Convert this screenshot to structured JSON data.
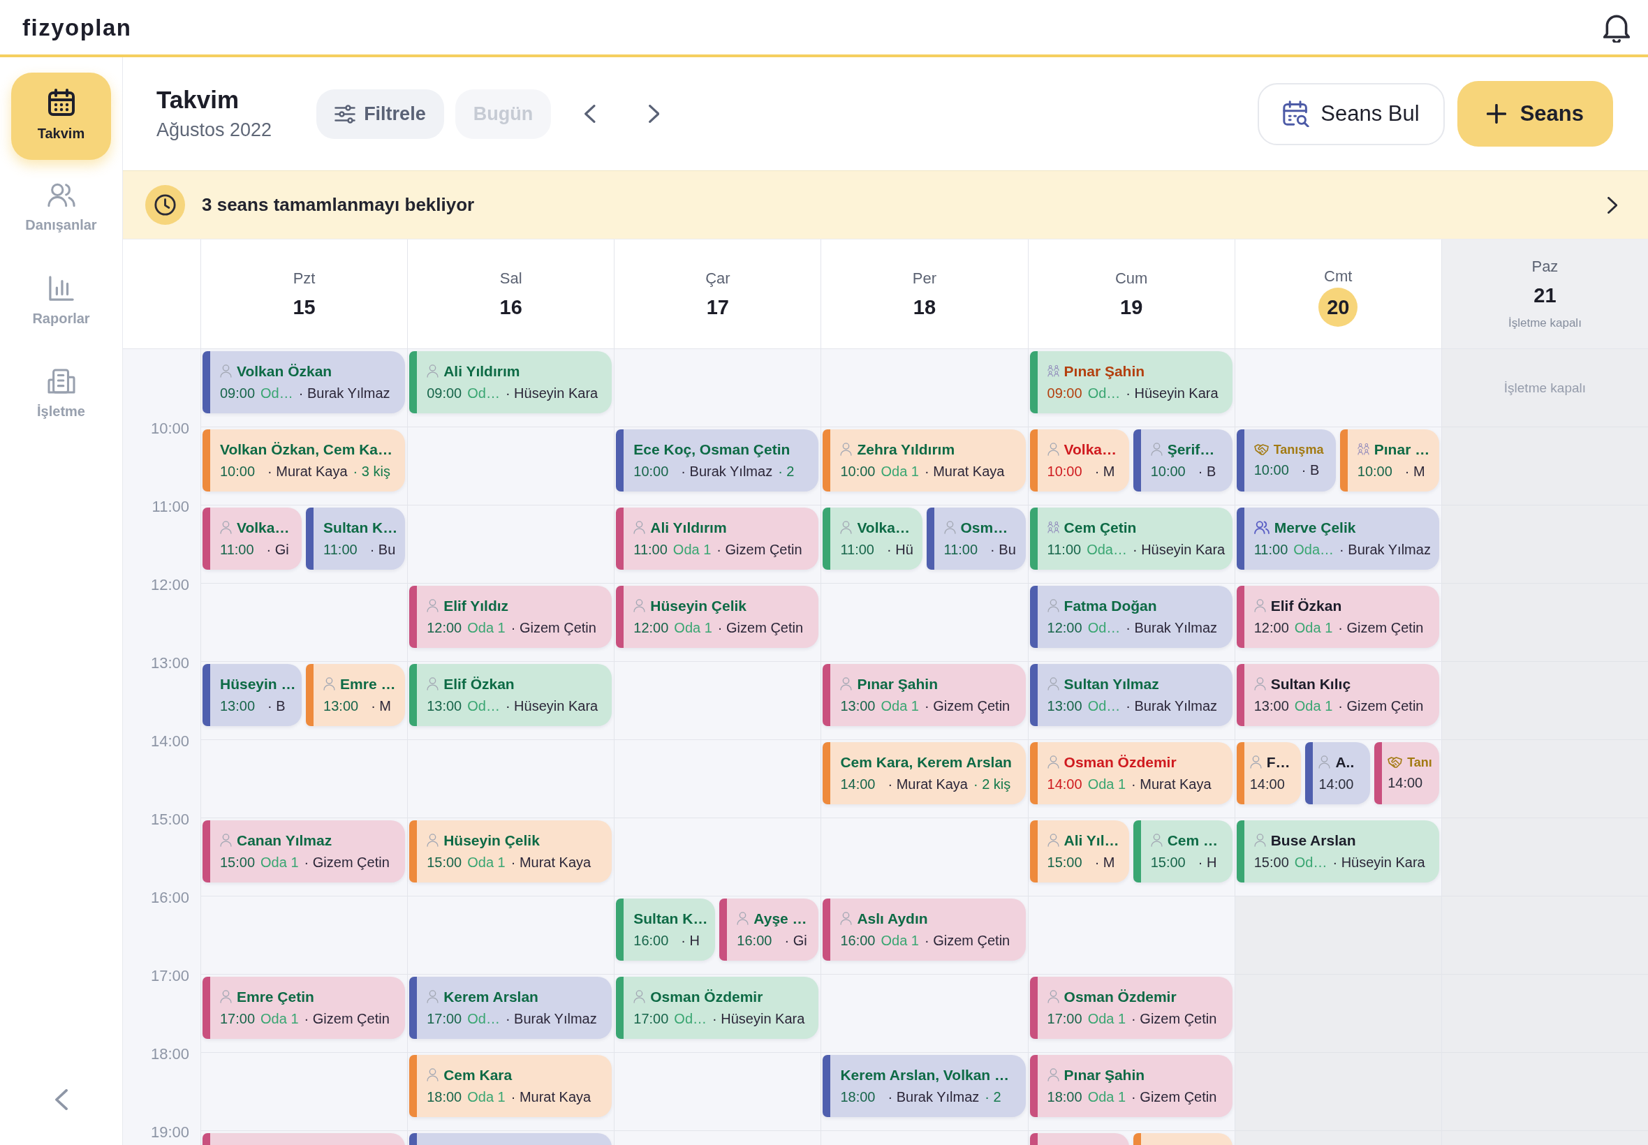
{
  "topbar": {
    "logo": "fizyoplan"
  },
  "sidebar": {
    "items": [
      {
        "label": "Takvim",
        "selected": true
      },
      {
        "label": "Danışanlar",
        "selected": false
      },
      {
        "label": "Raporlar",
        "selected": false
      },
      {
        "label": "İşletme",
        "selected": false
      }
    ]
  },
  "header": {
    "title": "Takvim",
    "subtitle": "Ağustos 2022",
    "filter_button": "Filtrele",
    "today_button": {
      "label": "Bugün",
      "disabled": true
    },
    "find_button": "Seans Bul",
    "new_button": "Seans"
  },
  "banner": {
    "text": "3 seans tamamlanmayı bekliyor"
  },
  "calendar": {
    "hours": [
      "10:00",
      "11:00",
      "12:00",
      "13:00",
      "14:00",
      "15:00",
      "16:00",
      "17:00",
      "18:00",
      "19:00"
    ],
    "days": [
      {
        "name": "Pzt",
        "date": "15",
        "today": false,
        "closed": false,
        "slots": [
          {
            "kind": "open",
            "events": [
              {
                "name": "Volkan Özkan",
                "kind": "individual",
                "awaiting_completion": false,
                "upcoming": false,
                "time": "09:00",
                "room": "Od…",
                "therapist": "· Burak Yılmaz",
                "color": "#4f5fae"
              }
            ]
          },
          {
            "kind": "open",
            "events": [
              {
                "name": "Volkan Özkan, Cem Ka…",
                "kind": "multi",
                "awaiting_completion": false,
                "upcoming": false,
                "time": "10:00",
                "therapist": "· Murat Kaya",
                "participants": "· 3 kiş",
                "color": "#ee8a3c"
              }
            ]
          },
          {
            "kind": "open",
            "events": [
              {
                "name": "Volka…",
                "kind": "individual",
                "awaiting_completion": false,
                "upcoming": false,
                "time": "11:00",
                "therapist": "· Gi",
                "color": "#c9507e"
              },
              {
                "name": "Sultan K…",
                "kind": "multi",
                "awaiting_completion": false,
                "upcoming": false,
                "time": "11:00",
                "therapist": "· Bu",
                "color": "#4f5fae"
              }
            ]
          },
          {
            "kind": "open"
          },
          {
            "kind": "open",
            "events": [
              {
                "name": "Hüseyin …",
                "kind": "multi",
                "awaiting_completion": false,
                "upcoming": false,
                "time": "13:00",
                "therapist": "· B",
                "color": "#4f5fae"
              },
              {
                "name": "Emre …",
                "kind": "individual",
                "awaiting_completion": false,
                "upcoming": false,
                "time": "13:00",
                "therapist": "· M",
                "color": "#ee8a3c"
              }
            ]
          },
          {
            "kind": "open"
          },
          {
            "kind": "open",
            "events": [
              {
                "name": "Canan Yılmaz",
                "kind": "individual",
                "awaiting_completion": false,
                "upcoming": false,
                "time": "15:00",
                "room": "Oda 1",
                "therapist": "· Gizem Çetin",
                "color": "#c9507e"
              }
            ]
          },
          {
            "kind": "open"
          },
          {
            "kind": "open",
            "events": [
              {
                "name": "Emre Çetin",
                "kind": "individual",
                "awaiting_completion": false,
                "upcoming": false,
                "time": "17:00",
                "room": "Oda 1",
                "therapist": "· Gizem Çetin",
                "color": "#c9507e"
              }
            ]
          },
          {
            "kind": "open"
          },
          {
            "kind": "open",
            "events": [
              {
                "color": "#c9507e"
              }
            ]
          }
        ]
      },
      {
        "name": "Sal",
        "date": "16",
        "today": false,
        "closed": false,
        "slots": [
          {
            "kind": "open",
            "events": [
              {
                "name": "Ali Yıldırım",
                "kind": "individual",
                "awaiting_completion": false,
                "upcoming": false,
                "time": "09:00",
                "room": "Od…",
                "therapist": "· Hüseyin Kara",
                "color": "#3aa672"
              }
            ]
          },
          {
            "kind": "open"
          },
          {
            "kind": "open"
          },
          {
            "kind": "open",
            "events": [
              {
                "name": "Elif Yıldız",
                "kind": "individual",
                "awaiting_completion": false,
                "upcoming": false,
                "time": "12:00",
                "room": "Oda 1",
                "therapist": "· Gizem Çetin",
                "color": "#c9507e"
              }
            ]
          },
          {
            "kind": "open",
            "events": [
              {
                "name": "Elif Özkan",
                "kind": "individual",
                "awaiting_completion": false,
                "upcoming": false,
                "time": "13:00",
                "room": "Od…",
                "therapist": "· Hüseyin Kara",
                "color": "#3aa672"
              }
            ]
          },
          {
            "kind": "open"
          },
          {
            "kind": "open",
            "events": [
              {
                "name": "Hüseyin Çelik",
                "kind": "individual",
                "awaiting_completion": false,
                "upcoming": false,
                "time": "15:00",
                "room": "Oda 1",
                "therapist": "· Murat Kaya",
                "color": "#ee8a3c"
              }
            ]
          },
          {
            "kind": "open"
          },
          {
            "kind": "open",
            "events": [
              {
                "name": "Kerem Arslan",
                "kind": "individual",
                "awaiting_completion": false,
                "upcoming": false,
                "time": "17:00",
                "room": "Od…",
                "therapist": "· Burak Yılmaz",
                "color": "#4f5fae"
              }
            ]
          },
          {
            "kind": "open",
            "events": [
              {
                "name": "Cem Kara",
                "kind": "individual",
                "awaiting_completion": false,
                "upcoming": false,
                "time": "18:00",
                "room": "Oda 1",
                "therapist": "· Murat Kaya",
                "color": "#ee8a3c"
              }
            ]
          },
          {
            "kind": "open",
            "events": [
              {
                "color": "#4f5fae"
              }
            ]
          }
        ]
      },
      {
        "name": "Çar",
        "date": "17",
        "today": false,
        "closed": false,
        "slots": [
          {
            "kind": "open"
          },
          {
            "kind": "open",
            "events": [
              {
                "name": "Ece Koç, Osman Çetin",
                "kind": "multi",
                "awaiting_completion": false,
                "upcoming": false,
                "time": "10:00",
                "therapist": "· Burak Yılmaz",
                "participants": "· 2",
                "color": "#4f5fae"
              }
            ]
          },
          {
            "kind": "open",
            "events": [
              {
                "name": "Ali Yıldırım",
                "kind": "individual",
                "awaiting_completion": false,
                "upcoming": false,
                "time": "11:00",
                "room": "Oda 1",
                "therapist": "· Gizem Çetin",
                "color": "#c9507e"
              }
            ]
          },
          {
            "kind": "open",
            "events": [
              {
                "name": "Hüseyin Çelik",
                "kind": "individual",
                "awaiting_completion": false,
                "upcoming": false,
                "time": "12:00",
                "room": "Oda 1",
                "therapist": "· Gizem Çetin",
                "color": "#c9507e"
              }
            ]
          },
          {
            "kind": "open"
          },
          {
            "kind": "open"
          },
          {
            "kind": "open"
          },
          {
            "kind": "open",
            "events": [
              {
                "name": "Sultan K…",
                "kind": "multi",
                "awaiting_completion": false,
                "upcoming": false,
                "time": "16:00",
                "therapist": "· H",
                "color": "#3aa672"
              },
              {
                "name": "Ayşe …",
                "kind": "individual",
                "awaiting_completion": false,
                "upcoming": false,
                "time": "16:00",
                "therapist": "· Gi",
                "color": "#c9507e"
              }
            ]
          },
          {
            "kind": "open",
            "events": [
              {
                "name": "Osman Özdemir",
                "kind": "individual",
                "awaiting_completion": false,
                "upcoming": false,
                "time": "17:00",
                "room": "Od…",
                "therapist": "· Hüseyin Kara",
                "color": "#3aa672"
              }
            ]
          },
          {
            "kind": "open"
          }
        ]
      },
      {
        "name": "Per",
        "date": "18",
        "today": false,
        "closed": false,
        "slots": [
          {
            "kind": "open"
          },
          {
            "kind": "open",
            "events": [
              {
                "name": "Zehra Yıldırım",
                "kind": "individual",
                "awaiting_completion": false,
                "upcoming": false,
                "time": "10:00",
                "room": "Oda 1",
                "therapist": "· Murat Kaya",
                "color": "#ee8a3c"
              }
            ]
          },
          {
            "kind": "open",
            "events": [
              {
                "name": "Volka…",
                "kind": "individual",
                "awaiting_completion": false,
                "upcoming": false,
                "time": "11:00",
                "therapist": "· Hü",
                "color": "#3aa672"
              },
              {
                "name": "Osm…",
                "kind": "individual",
                "awaiting_completion": false,
                "upcoming": false,
                "time": "11:00",
                "therapist": "· Bu",
                "color": "#4f5fae"
              }
            ]
          },
          {
            "kind": "open"
          },
          {
            "kind": "open",
            "events": [
              {
                "name": "Pınar Şahin",
                "kind": "individual",
                "awaiting_completion": false,
                "upcoming": false,
                "time": "13:00",
                "room": "Oda 1",
                "therapist": "· Gizem Çetin",
                "color": "#c9507e"
              }
            ]
          },
          {
            "kind": "open",
            "events": [
              {
                "name": "Cem Kara, Kerem Arslan",
                "kind": "multi",
                "awaiting_completion": false,
                "upcoming": false,
                "time": "14:00",
                "therapist": "· Murat Kaya",
                "participants": "· 2 kiş",
                "color": "#ee8a3c"
              }
            ]
          },
          {
            "kind": "open"
          },
          {
            "kind": "open",
            "events": [
              {
                "name": "Aslı Aydın",
                "kind": "individual",
                "awaiting_completion": false,
                "upcoming": false,
                "time": "16:00",
                "room": "Oda 1",
                "therapist": "· Gizem Çetin",
                "color": "#c9507e"
              }
            ]
          },
          {
            "kind": "open"
          },
          {
            "kind": "open",
            "events": [
              {
                "name": "Kerem Arslan, Volkan …",
                "kind": "multi",
                "awaiting_completion": false,
                "upcoming": false,
                "time": "18:00",
                "therapist": "· Burak Yılmaz",
                "participants": "· 2",
                "color": "#4f5fae"
              }
            ]
          }
        ]
      },
      {
        "name": "Cum",
        "date": "19",
        "today": false,
        "closed": false,
        "slots": [
          {
            "kind": "open",
            "events": [
              {
                "name": "Pınar Şahin",
                "kind": "group",
                "awaiting_completion": true,
                "upcoming": false,
                "time": "09:00",
                "room": "Od…",
                "therapist": "· Hüseyin Kara",
                "color": "#3aa672"
              }
            ]
          },
          {
            "kind": "open",
            "events": [
              {
                "name": "Volka…",
                "kind": "individual",
                "awaiting_completion": true,
                "upcoming": false,
                "time": "10:00",
                "therapist": "· M",
                "color": "#ee8a3c"
              },
              {
                "name": "Şerif…",
                "kind": "individual",
                "awaiting_completion": false,
                "upcoming": false,
                "time": "10:00",
                "therapist": "· B",
                "color": "#4f5fae"
              }
            ]
          },
          {
            "kind": "open",
            "events": [
              {
                "name": "Cem Çetin",
                "kind": "group",
                "awaiting_completion": false,
                "upcoming": false,
                "time": "11:00",
                "room": "Oda…",
                "therapist": "· Hüseyin Kara",
                "color": "#3aa672"
              }
            ]
          },
          {
            "kind": "open",
            "events": [
              {
                "name": "Fatma Doğan",
                "kind": "individual",
                "awaiting_completion": false,
                "upcoming": false,
                "time": "12:00",
                "room": "Od…",
                "therapist": "· Burak Yılmaz",
                "color": "#4f5fae"
              }
            ]
          },
          {
            "kind": "open",
            "events": [
              {
                "name": "Sultan Yılmaz",
                "kind": "individual",
                "awaiting_completion": false,
                "upcoming": false,
                "time": "13:00",
                "room": "Od…",
                "therapist": "· Burak Yılmaz",
                "color": "#4f5fae"
              }
            ]
          },
          {
            "kind": "open",
            "events": [
              {
                "name": "Osman Özdemir",
                "kind": "individual",
                "awaiting_completion": true,
                "upcoming": false,
                "time": "14:00",
                "room": "Oda 1",
                "therapist": "· Murat Kaya",
                "color": "#ee8a3c"
              }
            ]
          },
          {
            "kind": "open",
            "events": [
              {
                "name": "Ali Yıl…",
                "kind": "individual",
                "awaiting_completion": false,
                "upcoming": false,
                "time": "15:00",
                "therapist": "· M",
                "color": "#ee8a3c"
              },
              {
                "name": "Cem …",
                "kind": "individual",
                "awaiting_completion": false,
                "upcoming": false,
                "time": "15:00",
                "therapist": "· H",
                "color": "#3aa672"
              }
            ]
          },
          {
            "kind": "open"
          },
          {
            "kind": "open",
            "events": [
              {
                "name": "Osman Özdemir",
                "kind": "individual",
                "awaiting_completion": false,
                "upcoming": false,
                "time": "17:00",
                "room": "Oda 1",
                "therapist": "· Gizem Çetin",
                "color": "#c9507e"
              }
            ]
          },
          {
            "kind": "open",
            "events": [
              {
                "name": "Pınar Şahin",
                "kind": "individual",
                "awaiting_completion": false,
                "upcoming": false,
                "time": "18:00",
                "room": "Oda 1",
                "therapist": "· Gizem Çetin",
                "color": "#c9507e"
              }
            ]
          },
          {
            "kind": "open",
            "events": [
              {
                "color": "#c9507e"
              },
              {
                "color": "#ee8a3c"
              }
            ]
          }
        ]
      },
      {
        "name": "Cmt",
        "date": "20",
        "today": true,
        "closed": false,
        "slots": [
          {
            "kind": "open"
          },
          {
            "kind": "open",
            "events": [
              {
                "name": "Tanışma",
                "kind": "intro",
                "awaiting_completion": false,
                "upcoming": false,
                "time": "10:00",
                "therapist": "· B",
                "color": "#4f5fae"
              },
              {
                "name": "Pınar …",
                "kind": "group",
                "awaiting_completion": false,
                "upcoming": false,
                "time": "10:00",
                "therapist": "· M",
                "color": "#ee8a3c"
              }
            ]
          },
          {
            "kind": "open",
            "events": [
              {
                "name": "Merve Çelik",
                "kind": "pair",
                "awaiting_completion": false,
                "upcoming": false,
                "time": "11:00",
                "room": "Oda…",
                "therapist": "· Burak Yılmaz",
                "color": "#4f5fae"
              }
            ]
          },
          {
            "kind": "open",
            "events": [
              {
                "name": "Elif Özkan",
                "kind": "individual",
                "awaiting_completion": false,
                "upcoming": true,
                "time": "12:00",
                "room": "Oda 1",
                "therapist": "· Gizem Çetin",
                "color": "#c9507e"
              }
            ]
          },
          {
            "kind": "open",
            "events": [
              {
                "name": "Sultan Kılıç",
                "kind": "individual",
                "awaiting_completion": false,
                "upcoming": true,
                "time": "13:00",
                "room": "Oda 1",
                "therapist": "· Gizem Çetin",
                "color": "#c9507e"
              }
            ]
          },
          {
            "kind": "open",
            "events": [
              {
                "name": "F…",
                "kind": "individual",
                "awaiting_completion": false,
                "upcoming": true,
                "time": "14:00",
                "color": "#ee8a3c"
              },
              {
                "name": "A..",
                "kind": "individual",
                "awaiting_completion": false,
                "upcoming": true,
                "time": "14:00",
                "color": "#4f5fae"
              },
              {
                "name": "Tanı",
                "kind": "intro",
                "awaiting_completion": false,
                "upcoming": true,
                "time": "14:00",
                "color": "#c9507e"
              }
            ]
          },
          {
            "kind": "open",
            "events": [
              {
                "name": "Buse Arslan",
                "kind": "individual",
                "awaiting_completion": false,
                "upcoming": true,
                "time": "15:00",
                "room": "Od…",
                "therapist": "· Hüseyin Kara",
                "color": "#3aa672"
              }
            ]
          },
          {
            "kind": "closed"
          },
          {
            "kind": "closed"
          },
          {
            "kind": "closed"
          },
          {
            "kind": "closed"
          }
        ]
      },
      {
        "name": "Paz",
        "date": "21",
        "today": false,
        "closed": true,
        "note": "İşletme kapalı",
        "column_note": "İşletme kapalı"
      }
    ]
  }
}
